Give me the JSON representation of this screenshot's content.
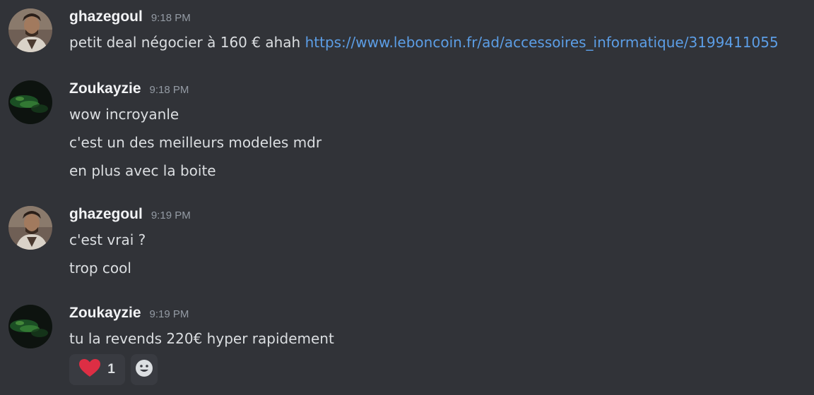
{
  "messages": [
    {
      "author": "ghazegoul",
      "time": "9:18 PM",
      "lines": [
        {
          "text": "petit deal négocier à 160 € ahah ",
          "link": "https://www.leboncoin.fr/ad/accessoires_informatique/3199411055"
        }
      ]
    },
    {
      "author": "Zoukayzie",
      "time": "9:18 PM",
      "lines": [
        {
          "text": "wow incroyanle"
        },
        {
          "text": "c'est un des meilleurs modeles mdr"
        },
        {
          "text": "en plus avec la boite"
        }
      ]
    },
    {
      "author": "ghazegoul",
      "time": "9:19 PM",
      "lines": [
        {
          "text": "c'est vrai ?"
        },
        {
          "text": "trop cool"
        }
      ]
    },
    {
      "author": "Zoukayzie",
      "time": "9:19 PM",
      "lines": [
        {
          "text": "tu la revends 220€ hyper rapidement"
        }
      ],
      "reactions": [
        {
          "emoji": "heart-icon",
          "count": "1"
        }
      ]
    }
  ],
  "colors": {
    "background": "#313338",
    "text": "#dbdee1",
    "username": "#f2f3f5",
    "timestamp": "#949ba4",
    "link": "#5c9ee6",
    "reaction_bg": "#393b41",
    "heart": "#dd2e44"
  }
}
